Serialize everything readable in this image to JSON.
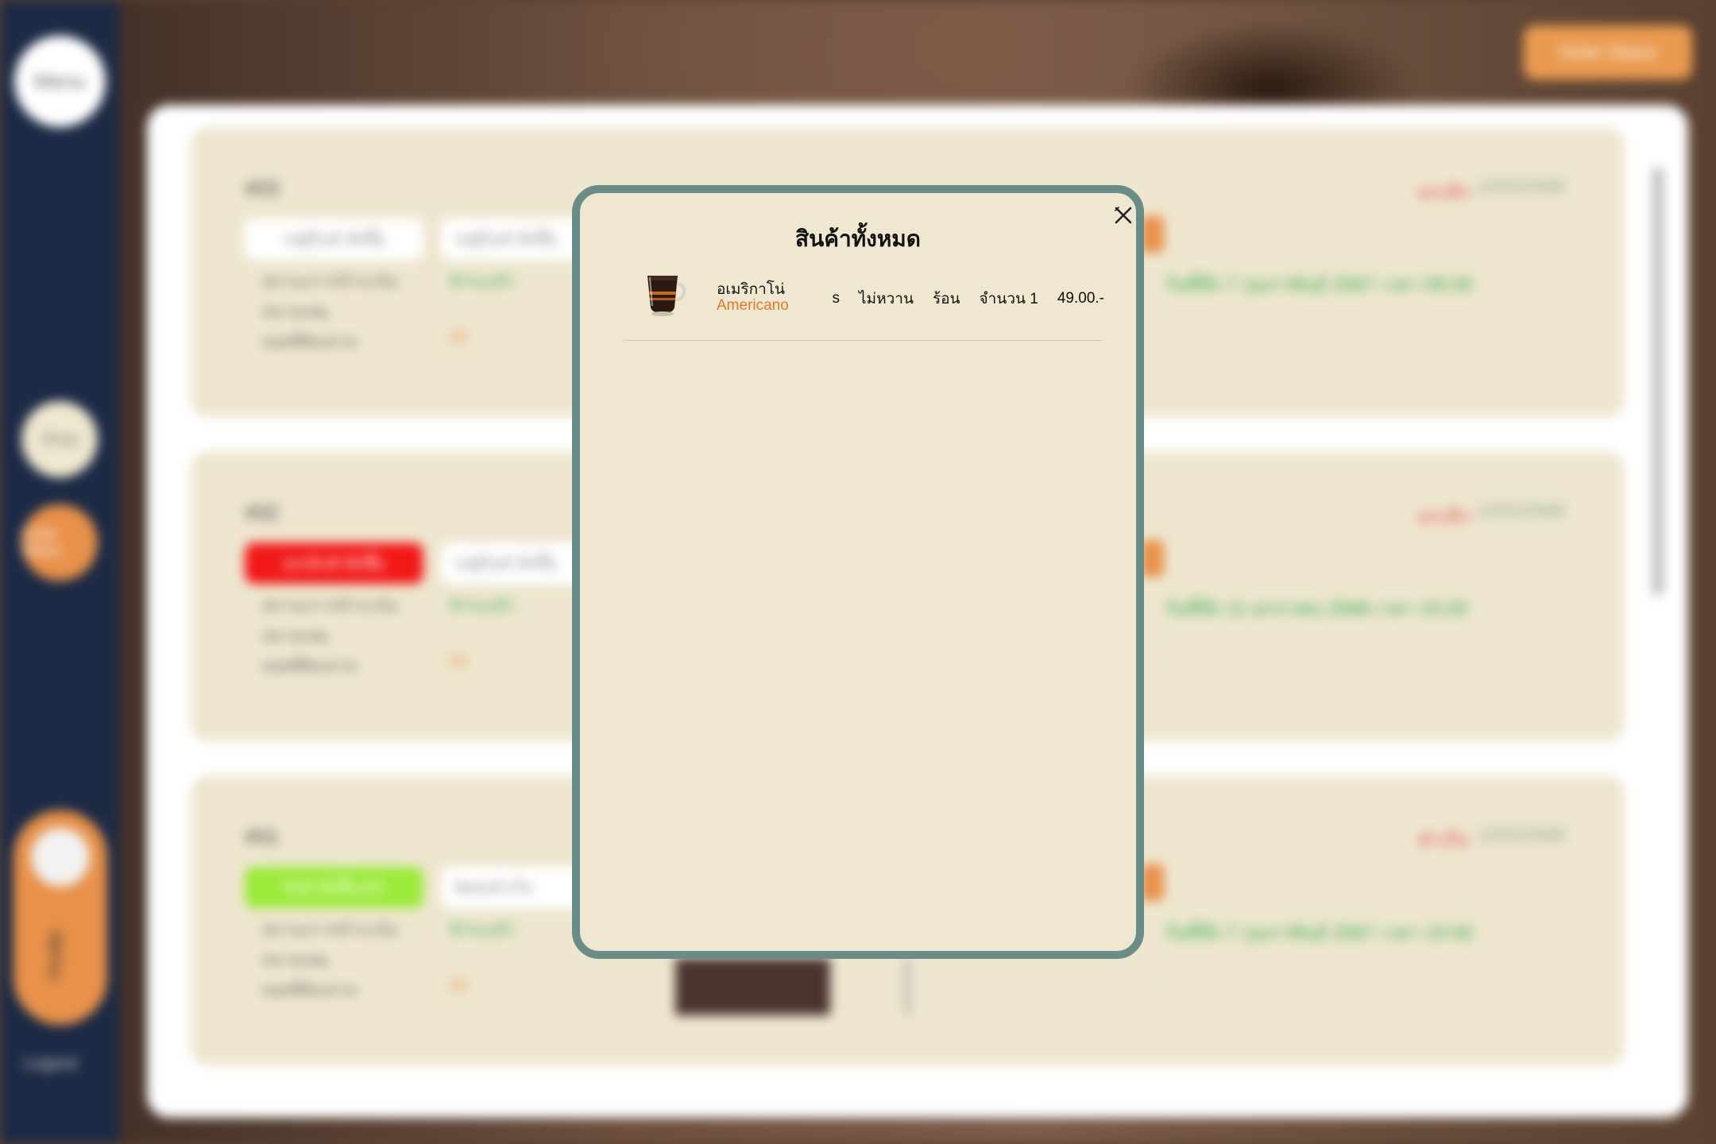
{
  "background": {
    "sidebar": {
      "menu_label": "Menu",
      "item1_label": "Shop",
      "item2_label": "Order Status",
      "profile_label": "Profile",
      "logout_label": "Logout"
    },
    "top_button_label": "Order Status",
    "orders": [
      {
        "id": "#03",
        "status_pill": "รอผู้รับคำสั่งซื้อ",
        "status_pill2": "รอผู้รับคำสั่งซื้อ",
        "payment_label": "สถานะการชำระเงิน",
        "payment_value": "ชำระแล้ว",
        "note_label": "หมายเหตุ",
        "note_value": "-",
        "total_label": "ยอดที่ต้องจ่าย",
        "total_value": "49",
        "right_status": "ยกเลิก",
        "right_date": "22/02/2568",
        "right_green": "วันที่สั่ง 7 กุมภาพันธ์ 2567 เวลา 09:30"
      },
      {
        "id": "#02",
        "status_pill": "ยกเลิกคำสั่งซื้อ",
        "status_pill2": "รอผู้รับคำสั่งซื้อ",
        "payment_label": "สถานะการชำระเงิน",
        "payment_value": "ชำระแล้ว",
        "note_label": "หมายเหตุ",
        "note_value": "-",
        "total_label": "ยอดที่ต้องจ่าย",
        "total_value": "49",
        "right_status": "ยกเลิก",
        "right_date": "22/02/2568",
        "right_green": "วันที่สั่ง 11 มกราคม 2568 เวลา 15:20"
      },
      {
        "id": "#01",
        "status_pill": "รับคำสั่งซื้อแล้ว",
        "status_pill2": "จัดส่งสำเร็จ",
        "payment_label": "สถานะการชำระเงิน",
        "payment_value": "ชำระแล้ว",
        "note_label": "หมายเหตุ",
        "note_value": "-",
        "total_label": "ยอดที่ต้องจ่าย",
        "total_value": "49",
        "right_status": "สำเร็จ",
        "right_date": "22/02/2568",
        "right_green": "วันที่สั่ง 7 กุมภาพันธ์ 2567 เวลา 10:40"
      }
    ]
  },
  "modal": {
    "title": "สินค้าทั้งหมด",
    "close_icon": "close-icon",
    "items": [
      {
        "name_th": "อเมริกาโน่",
        "name_en": "Americano",
        "size": "s",
        "sweetness": "ไม่หวาน",
        "temperature": "ร้อน",
        "quantity": "จำนวน 1",
        "price": "49.00.-"
      }
    ]
  },
  "colors": {
    "sidebar": "#1c2a45",
    "accent_orange": "#e8914a",
    "modal_border": "#6a8c86",
    "modal_bg": "#efe7d0",
    "english_name": "#e07a2a"
  }
}
